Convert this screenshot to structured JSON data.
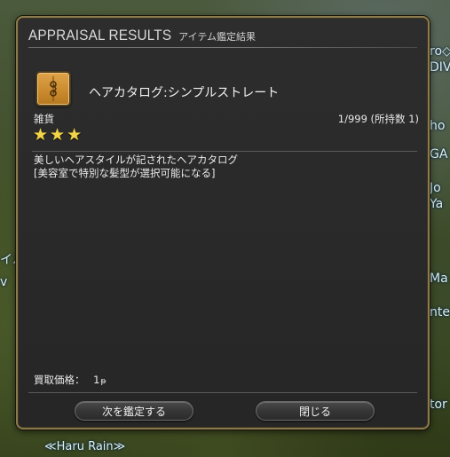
{
  "window": {
    "title_en": "APPRAISAL RESULTS",
    "title_jp": "アイテム鑑定結果"
  },
  "item": {
    "icon": "hair-catalog-envelope-icon",
    "name": "ヘアカタログ:シンプルストレート",
    "category": "雑貨",
    "stack": "1/999 (所持数 1)",
    "rating_stars": 3,
    "description_lines": [
      "美しいヘアスタイルが記されたヘアカタログ",
      "[美容室で特別な髪型が選択可能になる]"
    ],
    "price_label": "買取価格：",
    "price_value": "1"
  },
  "buttons": {
    "appraise_next": "次を鑑定する",
    "close": "閉じる"
  },
  "background_labels": {
    "right": [
      "ro◇",
      "DIV",
      "ho",
      "GA",
      "Jo",
      "Ya",
      "Ma",
      "nte",
      "tor"
    ],
    "left": [
      "イル",
      "v"
    ],
    "bottom_name": "≪Haru Rain≫"
  },
  "colors": {
    "frame_gold": "#8c7a4f",
    "panel_bg": "#2a2a2a",
    "star": "#f2d54a"
  }
}
